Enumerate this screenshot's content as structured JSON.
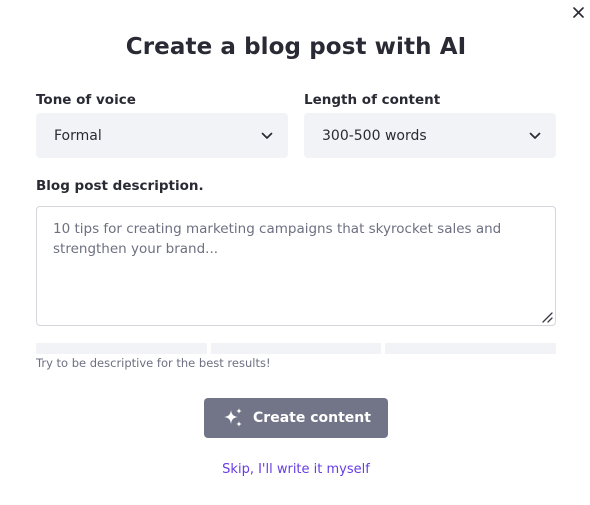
{
  "dialog": {
    "title": "Create a blog post with AI",
    "close_icon": "close-icon"
  },
  "tone": {
    "label": "Tone of voice",
    "value": "Formal",
    "icon": "chevron-down-icon"
  },
  "length": {
    "label": "Length of content",
    "value": "300-500 words",
    "icon": "chevron-down-icon"
  },
  "description": {
    "label": "Blog post description.",
    "value": "",
    "placeholder": "10 tips for creating marketing campaigns that skyrocket sales and strengthen your brand...",
    "hint": "Try to be descriptive for the best results!"
  },
  "actions": {
    "create_label": "Create content",
    "create_icon": "sparkles-icon",
    "skip_label": "Skip, I'll write it myself"
  },
  "colors": {
    "heading_text": "#2a2a35",
    "field_background": "#f2f3f6",
    "button_disabled": "#727587",
    "link": "#673de6"
  }
}
